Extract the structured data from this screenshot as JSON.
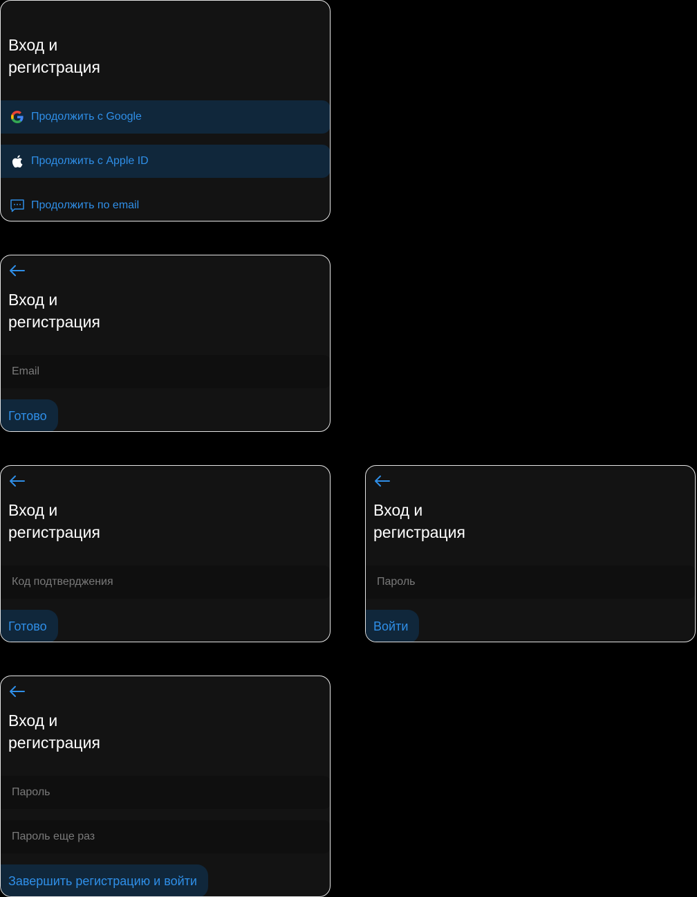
{
  "colors": {
    "page_background": "#000000",
    "card_background": "#131313",
    "card_border": "#e6e6e6",
    "accent": "#2f8fe8",
    "accent_surface": "#10273b",
    "field_background": "#0f0f0f",
    "placeholder": "#7a7a7a",
    "title": "#ffffff"
  },
  "screens": {
    "choose_method": {
      "title": "Вход и\nрегистрация",
      "options": [
        {
          "label": "Продолжить с Google",
          "icon": "google-icon"
        },
        {
          "label": "Продолжить с Apple ID",
          "icon": "apple-icon"
        },
        {
          "label": "Продолжить по email",
          "icon": "message-icon"
        }
      ]
    },
    "email": {
      "back_icon": "arrow-left-icon",
      "title": "Вход и\nрегистрация",
      "email_field": {
        "placeholder": "Email",
        "value": ""
      },
      "submit_label": "Готово"
    },
    "code": {
      "back_icon": "arrow-left-icon",
      "title": "Вход и\nрегистрация",
      "code_field": {
        "placeholder": "Код подтверджения",
        "value": ""
      },
      "submit_label": "Готово"
    },
    "login_password": {
      "back_icon": "arrow-left-icon",
      "title": "Вход и\nрегистрация",
      "password_field": {
        "placeholder": "Пароль",
        "value": ""
      },
      "submit_label": "Войти"
    },
    "register_password": {
      "back_icon": "arrow-left-icon",
      "title": "Вход и\nрегистрация",
      "password_field": {
        "placeholder": "Пароль",
        "value": ""
      },
      "password_repeat_field": {
        "placeholder": "Пароль еще раз",
        "value": ""
      },
      "submit_label": "Завершить регистрацию и войти"
    }
  }
}
